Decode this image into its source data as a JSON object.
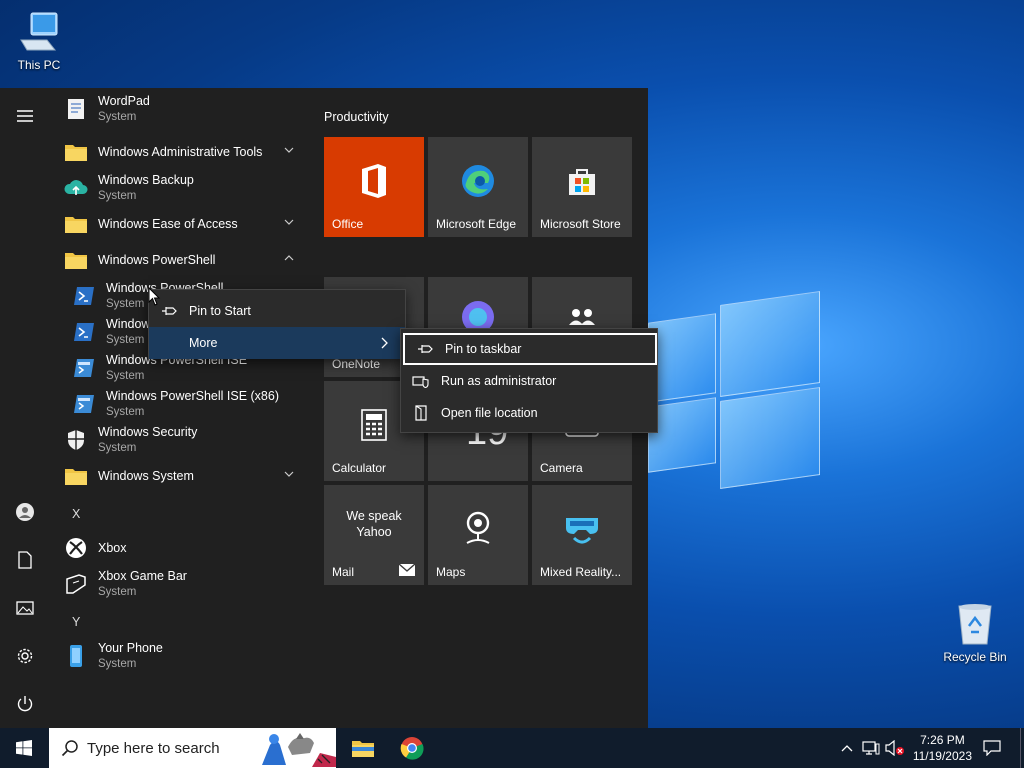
{
  "desktop": {
    "this_pc": "This PC",
    "recycle_bin": "Recycle Bin"
  },
  "start_menu": {
    "apps": [
      {
        "name": "WordPad",
        "sub": "System"
      },
      {
        "name": "Windows Administrative Tools"
      },
      {
        "name": "Windows Backup",
        "sub": "System"
      },
      {
        "name": "Windows Ease of Access"
      },
      {
        "name": "Windows PowerShell"
      },
      {
        "name": "Windows PowerShell",
        "sub": "System"
      },
      {
        "name": "Windows PowerShell (x86)",
        "sub": "System"
      },
      {
        "name": "Windows PowerShell ISE",
        "sub": "System"
      },
      {
        "name": "Windows PowerShell ISE (x86)",
        "sub": "System"
      },
      {
        "name": "Windows Security",
        "sub": "System"
      },
      {
        "name": "Windows System"
      },
      {
        "name": "Xbox"
      },
      {
        "name": "Xbox Game Bar",
        "sub": "System"
      },
      {
        "name": "Your Phone",
        "sub": "System"
      }
    ],
    "letters": [
      "X",
      "Y"
    ],
    "group_title": "Productivity",
    "tiles": [
      {
        "label": "Office",
        "color": "#d83b01"
      },
      {
        "label": "Microsoft Edge"
      },
      {
        "label": "Microsoft Store"
      },
      {
        "label": "OneNote"
      },
      {
        "label": "Calculator"
      },
      {
        "label": "Camera"
      },
      {
        "label": "We speak Yahoo"
      },
      {
        "label": "Mail"
      },
      {
        "label": "Maps"
      },
      {
        "label": "Mixed Reality..."
      }
    ],
    "calendar_day": "19"
  },
  "context_menu": {
    "items": [
      "Pin to Start",
      "More"
    ]
  },
  "submenu": {
    "items": [
      "Pin to taskbar",
      "Run as administrator",
      "Open file location"
    ]
  },
  "taskbar": {
    "search_placeholder": "Type here to search",
    "time": "7:26 PM",
    "date": "11/19/2023"
  },
  "colors": {
    "accent": "#0078d7",
    "highlight": "#1b3a5c"
  }
}
